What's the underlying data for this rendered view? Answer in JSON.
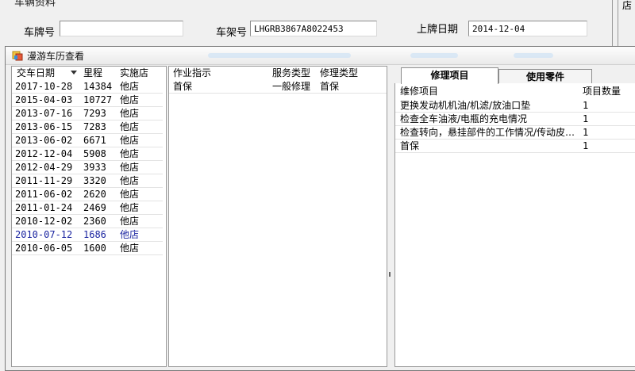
{
  "background_form": {
    "title": "车辆资料",
    "plate_label": "车牌号",
    "plate_value": "",
    "vin_label": "车架号",
    "vin_value": "LHGRB3867A8022453",
    "reg_date_label": "上牌日期",
    "reg_date_value": "2014-12-04",
    "corner_text": "店"
  },
  "dialog": {
    "title": "漫游车历查看",
    "icon": "app-window-icon"
  },
  "history_table": {
    "columns": [
      "交车日期",
      "里程",
      "实施店"
    ],
    "rows": [
      {
        "date": "2017-10-28",
        "mileage": "14384",
        "shop": "他店"
      },
      {
        "date": "2015-04-03",
        "mileage": "10727",
        "shop": "他店"
      },
      {
        "date": "2013-07-16",
        "mileage": "7293",
        "shop": "他店"
      },
      {
        "date": "2013-06-15",
        "mileage": "7283",
        "shop": "他店"
      },
      {
        "date": "2013-06-02",
        "mileage": "6671",
        "shop": "他店"
      },
      {
        "date": "2012-12-04",
        "mileage": "5908",
        "shop": "他店"
      },
      {
        "date": "2012-04-29",
        "mileage": "3933",
        "shop": "他店"
      },
      {
        "date": "2011-11-29",
        "mileage": "3320",
        "shop": "他店"
      },
      {
        "date": "2011-06-02",
        "mileage": "2620",
        "shop": "他店"
      },
      {
        "date": "2011-01-24",
        "mileage": "2469",
        "shop": "他店"
      },
      {
        "date": "2010-12-02",
        "mileage": "2360",
        "shop": "他店"
      },
      {
        "date": "2010-07-12",
        "mileage": "1686",
        "shop": "他店"
      },
      {
        "date": "2010-06-05",
        "mileage": "1600",
        "shop": "他店"
      }
    ],
    "selected_index": 11
  },
  "work_table": {
    "columns": [
      "作业指示",
      "服务类型",
      "修理类型"
    ],
    "rows": [
      {
        "instruction": "首保",
        "service_type": "一般修理",
        "repair_type": "首保"
      }
    ]
  },
  "tabs": [
    {
      "label": "修理项目",
      "active": true
    },
    {
      "label": "使用零件",
      "active": false
    }
  ],
  "repair_table": {
    "columns": [
      "维修项目",
      "项目数量"
    ],
    "rows": [
      {
        "item": "更换发动机机油/机滤/放油口垫",
        "qty": "1"
      },
      {
        "item": "检查全车油液/电瓶的充电情况",
        "qty": "1"
      },
      {
        "item": "检查转向，悬挂部件的工作情况/传动皮带...",
        "qty": "1"
      },
      {
        "item": "首保",
        "qty": "1"
      }
    ]
  }
}
